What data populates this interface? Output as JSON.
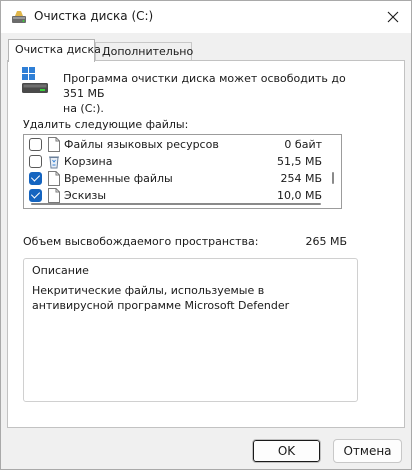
{
  "window": {
    "title": "Очистка диска  (C:)",
    "app_icon": "disk-cleanup-icon",
    "close_icon": "close-icon"
  },
  "tabs": [
    {
      "label": "Очистка диска",
      "active": true
    },
    {
      "label": "Дополнительно",
      "active": false
    }
  ],
  "main": {
    "intro_line1": "Программа очистки диска может освободить до 351 МБ",
    "intro_line2": "на  (C:).",
    "delete_label": "Удалить следующие файлы:",
    "files": [
      {
        "name": "Файлы языковых ресурсов",
        "size": "0 байт",
        "checked": false,
        "icon": "file-icon"
      },
      {
        "name": "Корзина",
        "size": "51,5 МБ",
        "checked": false,
        "icon": "recycle-bin-icon"
      },
      {
        "name": "Временные файлы",
        "size": "254 МБ",
        "checked": true,
        "icon": "file-icon"
      },
      {
        "name": "Эскизы",
        "size": "10,0 МБ",
        "checked": true,
        "icon": "file-icon"
      }
    ],
    "freed_label": "Объем высвобождаемого пространства:",
    "freed_value": "265 МБ",
    "description_title": "Описание",
    "description_text": "Некритические файлы, используемые в антивирусной программе Microsoft Defender"
  },
  "buttons": {
    "ok": "OK",
    "cancel": "Отмена"
  },
  "colors": {
    "accent": "#1464c0",
    "panel_bg": "#ffffff",
    "window_bg": "#f0f0f0"
  }
}
